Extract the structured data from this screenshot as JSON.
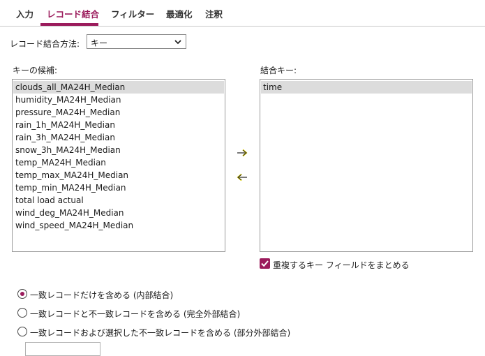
{
  "tabs": [
    {
      "label": "入力"
    },
    {
      "label": "レコード結合"
    },
    {
      "label": "フィルター"
    },
    {
      "label": "最適化"
    },
    {
      "label": "注釈"
    }
  ],
  "method": {
    "label": "レコード結合方法:",
    "value": "キー"
  },
  "candidates": {
    "label": "キーの候補:",
    "items": [
      "clouds_all_MA24H_Median",
      "humidity_MA24H_Median",
      "pressure_MA24H_Median",
      "rain_1h_MA24H_Median",
      "rain_3h_MA24H_Median",
      "snow_3h_MA24H_Median",
      "temp_MA24H_Median",
      "temp_max_MA24H_Median",
      "temp_min_MA24H_Median",
      "total load actual",
      "wind_deg_MA24H_Median",
      "wind_speed_MA24H_Median"
    ]
  },
  "join_keys": {
    "label": "結合キー:",
    "items": [
      "time"
    ]
  },
  "merge_duplicates": {
    "label": "重複するキー フィールドをまとめる",
    "checked": true
  },
  "join_types": [
    {
      "label": "一致レコードだけを含める (内部結合)",
      "selected": true
    },
    {
      "label": "一致レコードと不一致レコードを含める (完全外部結合)",
      "selected": false
    },
    {
      "label": "一致レコードおよび選択した不一致レコードを含める (部分外部結合)",
      "selected": false
    }
  ],
  "colors": {
    "accent": "#9b1b5c",
    "arrow": "#e8d800"
  }
}
